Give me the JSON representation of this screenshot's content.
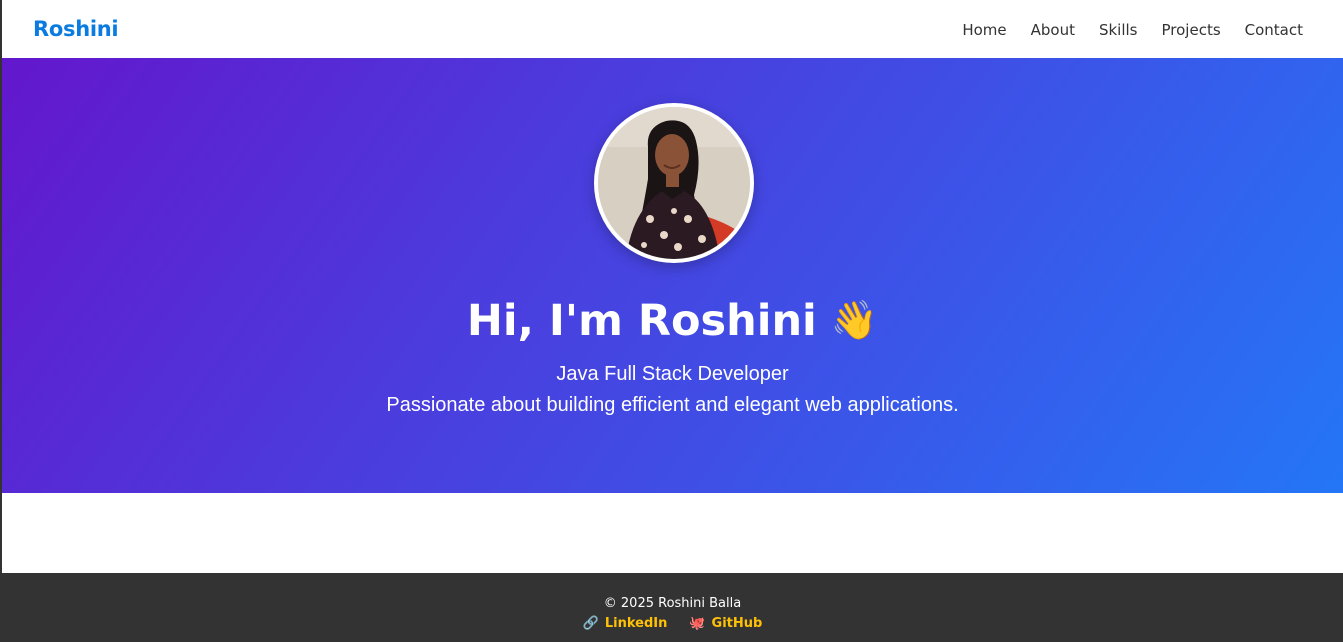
{
  "navbar": {
    "brand": "Roshini",
    "links": [
      "Home",
      "About",
      "Skills",
      "Projects",
      "Contact"
    ]
  },
  "hero": {
    "title": "Hi, I'm Roshini",
    "wave_emoji": "👋",
    "role": "Java Full Stack Developer",
    "tagline": "Passionate about building efficient and elegant web applications."
  },
  "footer": {
    "copyright": "© 2025 Roshini Balla",
    "links": [
      {
        "icon": "link-icon",
        "glyph": "🔗",
        "label": "LinkedIn"
      },
      {
        "icon": "octocat-icon",
        "glyph": "🐙",
        "label": "GitHub"
      }
    ]
  },
  "colors": {
    "brand": "#0a7be0",
    "nav_text": "#333333",
    "hero_gradient_start": "#6317cc",
    "hero_gradient_end": "#2476f7",
    "footer_bg": "#333333",
    "footer_link": "#ffc107"
  }
}
